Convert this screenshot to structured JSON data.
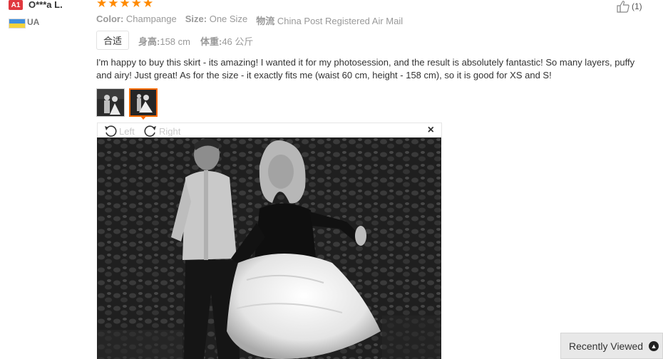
{
  "user": {
    "badge": "A1",
    "name": "O***a L.",
    "country": "UA"
  },
  "rating": {
    "stars": 5,
    "star_glyph": "★"
  },
  "helpful": {
    "count": "(1)"
  },
  "attributes": [
    {
      "key": "Color:",
      "value": "Champange"
    },
    {
      "key": "Size:",
      "value": "One Size"
    },
    {
      "key": "物流",
      "value": "China Post Registered Air Mail"
    }
  ],
  "fit": {
    "label": "合适"
  },
  "body_info": [
    {
      "key": "身高:",
      "value": "158 cm"
    },
    {
      "key": "体重:",
      "value": "46 公斤"
    }
  ],
  "review": {
    "text": "I'm happy to buy this skirt - its amazing! I wanted it for my photosession, and the result is absolutely fantastic! So many layers, puffy and airy! Just great! As for the size - it exactly fits me (waist 60 cm, height - 158 cm), so it is good for XS and S!"
  },
  "viewer": {
    "rotate_left": "Left",
    "rotate_right": "Right",
    "close": "×"
  },
  "recently_viewed": {
    "label": "Recently Viewed",
    "icon": "chevron-up-icon"
  },
  "colors": {
    "star": "#ff8a00",
    "accent": "#ff6a00",
    "badge": "#e0383e"
  }
}
